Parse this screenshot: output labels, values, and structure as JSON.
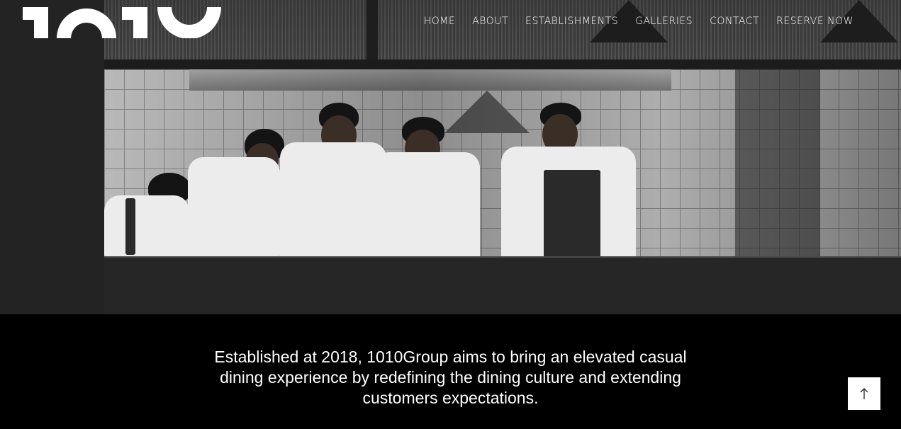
{
  "brand": {
    "logo_text": "1010"
  },
  "nav": {
    "items": [
      {
        "label": "HOME"
      },
      {
        "label": "ABOUT"
      },
      {
        "label": "ESTABLISHMENTS"
      },
      {
        "label": "GALLERIES"
      },
      {
        "label": "CONTACT"
      },
      {
        "label": "RESERVE NOW"
      }
    ]
  },
  "hero": {
    "image_alt": "Chefs working at a kitchen pass"
  },
  "intro": {
    "text": "Established at 2018, 1010Group aims to bring an elevated casual dining experience by redefining the dining culture and extending customers expectations."
  },
  "back_to_top": {
    "icon": "arrow-up-icon"
  },
  "colors": {
    "page_bg": "#000000",
    "hero_bg": "#232323",
    "text": "#ffffff",
    "button_bg": "#ffffff"
  }
}
